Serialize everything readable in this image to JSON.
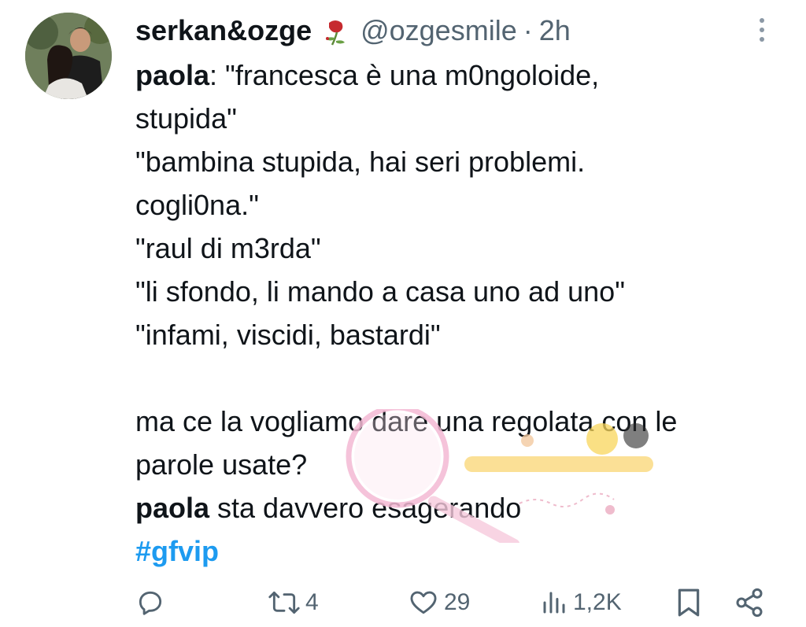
{
  "tweet": {
    "author_name": "serkan&ozge",
    "author_handle": "@ozgesmile",
    "separator": "·",
    "time": "2h",
    "lines": {
      "l1_bold": "paola",
      "l1_rest": ": \"francesca è una m0ngoloide,",
      "l2": "stupida\"",
      "l3": "\"bambina stupida, hai seri problemi.",
      "l4": "cogli0na.\"",
      "l5": "\"raul di m3rda\"",
      "l6": "\"li sfondo, li mando a casa uno ad uno\"",
      "l7": "\"infami, viscidi, bastardi\"",
      "l8": "ma ce la vogliamo dare una regolata con le",
      "l9": "parole usate?",
      "l10_bold": "paola",
      "l10_rest": " sta davvero esagerando",
      "hashtag": "#gfvip"
    }
  },
  "actions": {
    "reply_count": "",
    "retweet_count": "4",
    "like_count": "29",
    "views_count": "1,2K"
  },
  "icons": {
    "reply": "reply-icon",
    "retweet": "retweet-icon",
    "like": "heart-icon",
    "views": "analytics-icon",
    "bookmark": "bookmark-icon",
    "share": "share-icon",
    "more": "more-vertical-icon",
    "rose": "wilted-rose-emoji"
  },
  "colors": {
    "text": "#0f1419",
    "secondary": "#536471",
    "accent": "#1d9bf0"
  }
}
